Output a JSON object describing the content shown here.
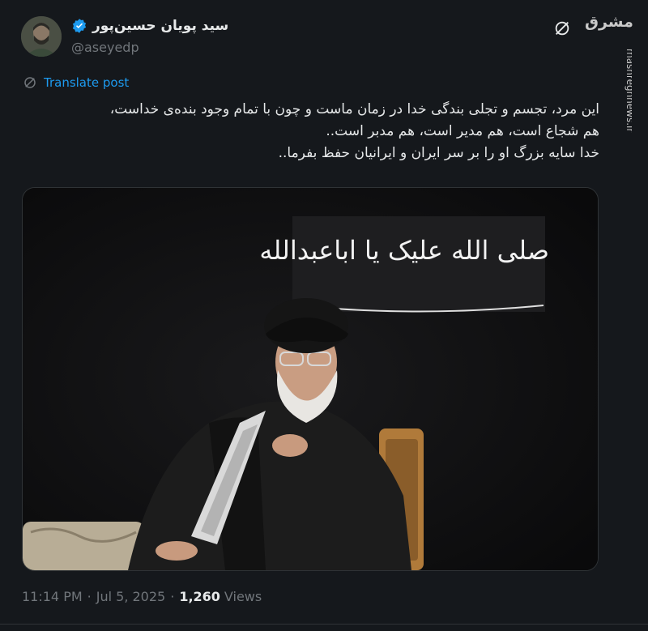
{
  "author": {
    "name": "سید پویان حسین‌پور",
    "handle": "@aseyedp",
    "verified": true
  },
  "header": {
    "grok_icon": "slashed-circle-icon",
    "watermark_logo": "مشرق",
    "watermark_url": "mashreghnews.ir"
  },
  "translate_label": "Translate post",
  "tweet": {
    "lines": [
      "این مرد، تجسم و تجلی بندگی خدا در زمان ماست و چون با تمام وجود بنده‌ی خداست،",
      "هم شجاع است، هم مدیر است، هم مدبر است..",
      "خدا سایه بزرگ او را بر سر ایران و ایرانیان حفظ بفرما.."
    ]
  },
  "media": {
    "banner_text": "صلی الله علیک یا اباعبدالله"
  },
  "meta": {
    "time": "11:14 PM",
    "date": "Jul 5, 2025",
    "separator": "·",
    "views_count": "1,260",
    "views_label": "Views"
  },
  "colors": {
    "background": "#15181c",
    "accent": "#1d9bf0",
    "secondary_text": "#71767b"
  }
}
